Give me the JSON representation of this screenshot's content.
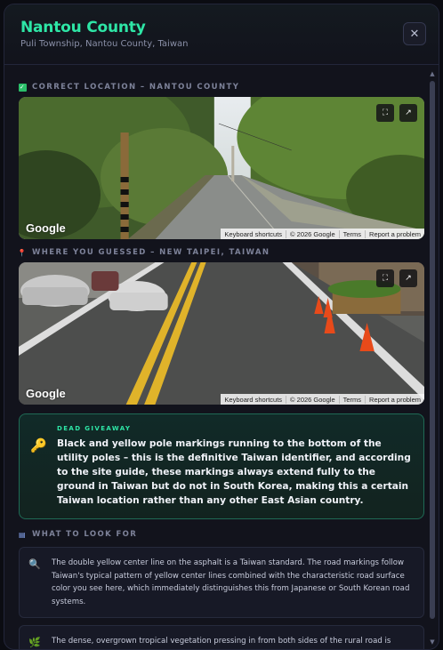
{
  "header": {
    "title": "Nantou County",
    "subtitle": "Puli Township, Nantou County, Taiwan",
    "close_label": "✕"
  },
  "correct": {
    "label": "CORRECT LOCATION – NANTOU COUNTY",
    "icon": "check-icon"
  },
  "guess": {
    "label": "WHERE YOU GUESSED – NEW TAIPEI, TAIWAN",
    "icon": "pin-icon"
  },
  "streetview": {
    "logo": "Google",
    "fullscreen_label": "⛶",
    "open_label": "↗",
    "attribution": [
      "Keyboard shortcuts",
      "© 2026 Google",
      "Terms",
      "Report a problem"
    ]
  },
  "giveaway": {
    "label": "DEAD GIVEAWAY",
    "icon": "key-icon",
    "text": "Black and yellow pole markings running to the bottom of the utility poles – this is the definitive Taiwan identifier, and according to the site guide, these markings always extend fully to the ground in Taiwan but do not in South Korea, making this a certain Taiwan location rather than any other East Asian country."
  },
  "look_for": {
    "label": "WHAT TO LOOK FOR",
    "icon": "book-icon",
    "tips": [
      {
        "icon": "magnifier-icon",
        "glyph": "🔍",
        "text": "The double yellow center line on the asphalt is a Taiwan standard. The road markings follow Taiwan's typical pattern of yellow center lines combined with the characteristic road surface color you see here, which immediately distinguishes this from Japanese or South Korean road systems."
      },
      {
        "icon": "leaf-icon",
        "glyph": "🌿",
        "text": "The dense, overgrown tropical vegetation pressing in from both sides of the rural road is"
      }
    ]
  },
  "colors": {
    "accent": "#2ee6a6",
    "giveaway_border": "#1f6a55",
    "key": "#f2b630"
  }
}
